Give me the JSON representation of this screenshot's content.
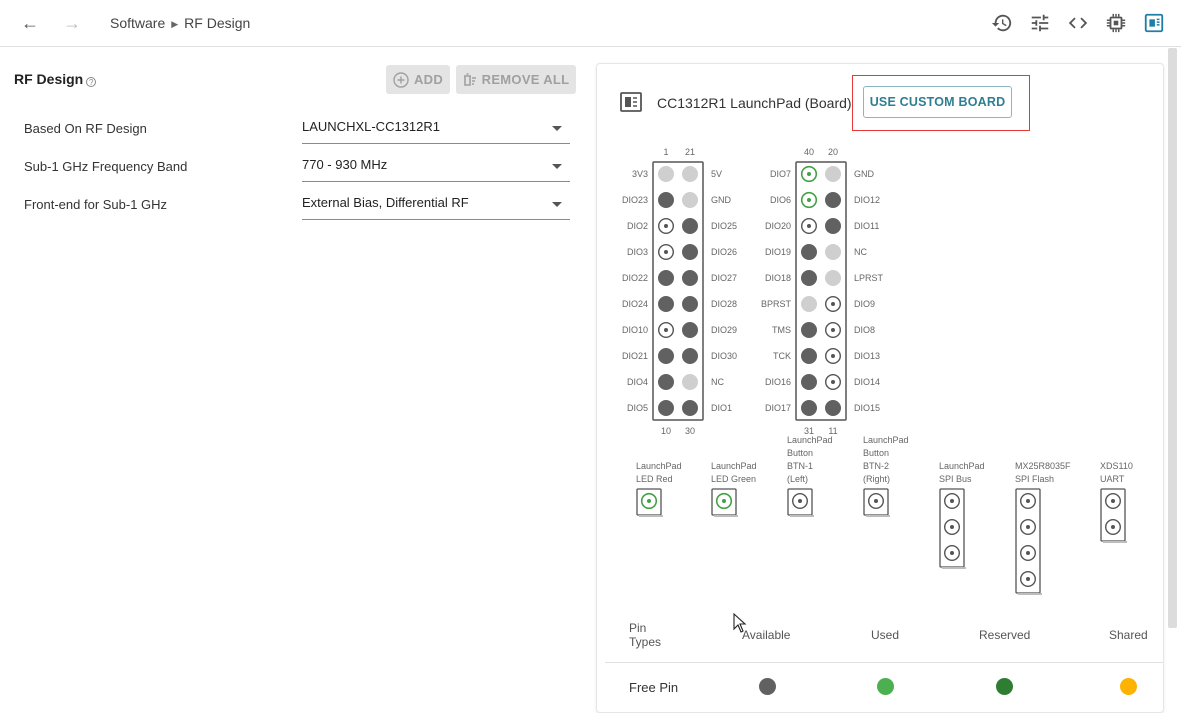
{
  "breadcrumb": {
    "root": "Software",
    "current": "RF Design"
  },
  "toolbar_icons": [
    "history-icon",
    "tune-icon",
    "code-icon",
    "chip-icon",
    "board-view-icon"
  ],
  "left": {
    "title": "RF Design",
    "add_label": "ADD",
    "remove_all_label": "REMOVE ALL",
    "fields": [
      {
        "label": "Based On RF Design",
        "value": "LAUNCHXL-CC1312R1"
      },
      {
        "label": "Sub-1 GHz Frequency Band",
        "value": "770 - 930 MHz"
      },
      {
        "label": "Front-end for Sub-1 GHz",
        "value": "External Bias, Differential RF"
      }
    ]
  },
  "board": {
    "title": "CC1312R1 LaunchPad (Board)",
    "custom_button": "USE CUSTOM BOARD",
    "header1": {
      "top_numbers": [
        "1",
        "21"
      ],
      "bottom_numbers": [
        "10",
        "30"
      ],
      "left_labels": [
        "3V3",
        "DIO23",
        "DIO2",
        "DIO3",
        "DIO22",
        "DIO24",
        "DIO10",
        "DIO21",
        "DIO4",
        "DIO5"
      ],
      "right_labels": [
        "5V",
        "GND",
        "DIO25",
        "DIO26",
        "DIO27",
        "DIO28",
        "DIO29",
        "DIO30",
        "NC",
        "DIO1"
      ],
      "left_pins": [
        "light",
        "dark",
        "ring",
        "ring",
        "dark",
        "dark",
        "ring",
        "dark",
        "dark",
        "dark"
      ],
      "right_pins": [
        "light",
        "light",
        "dark",
        "dark",
        "dark",
        "dark",
        "dark",
        "dark",
        "light",
        "dark"
      ]
    },
    "header2": {
      "top_numbers": [
        "40",
        "20"
      ],
      "bottom_numbers": [
        "31",
        "11"
      ],
      "left_labels": [
        "DIO7",
        "DIO6",
        "DIO20",
        "DIO19",
        "DIO18",
        "BPRST",
        "TMS",
        "TCK",
        "DIO16",
        "DIO17"
      ],
      "right_labels": [
        "GND",
        "DIO12",
        "DIO11",
        "NC",
        "LPRST",
        "DIO9",
        "DIO8",
        "DIO13",
        "DIO14",
        "DIO15"
      ],
      "left_pins": [
        "green",
        "green",
        "ring",
        "dark",
        "dark",
        "light",
        "dark",
        "dark",
        "dark",
        "dark"
      ],
      "right_pins": [
        "light",
        "dark",
        "dark",
        "light",
        "light",
        "ring",
        "ring",
        "ring",
        "ring",
        "dark"
      ]
    },
    "peripherals": [
      {
        "label": [
          "LaunchPad",
          "LED Red"
        ],
        "pins": [
          "green"
        ]
      },
      {
        "label": [
          "LaunchPad",
          "LED Green"
        ],
        "pins": [
          "green"
        ]
      },
      {
        "label": [
          "LaunchPad",
          "Button",
          "BTN-1",
          "(Left)"
        ],
        "pins": [
          "ring"
        ]
      },
      {
        "label": [
          "LaunchPad",
          "Button",
          "BTN-2",
          "(Right)"
        ],
        "pins": [
          "ring"
        ]
      },
      {
        "label": [
          "LaunchPad",
          "SPI Bus"
        ],
        "pins": [
          "ring",
          "ring",
          "ring"
        ]
      },
      {
        "label": [
          "MX25R8035F",
          "SPI Flash"
        ],
        "pins": [
          "ring",
          "ring",
          "ring",
          "ring"
        ]
      },
      {
        "label": [
          "XDS110",
          "UART"
        ],
        "pins": [
          "ring",
          "ring"
        ]
      }
    ]
  },
  "pin_types": {
    "header_label": [
      "Pin",
      "Types"
    ],
    "columns": [
      "Available",
      "Used",
      "Reserved",
      "Shared"
    ],
    "row_label": "Free Pin",
    "colors": [
      "#616161",
      "#4caf50",
      "#2e7d32",
      "#ffb300"
    ]
  }
}
